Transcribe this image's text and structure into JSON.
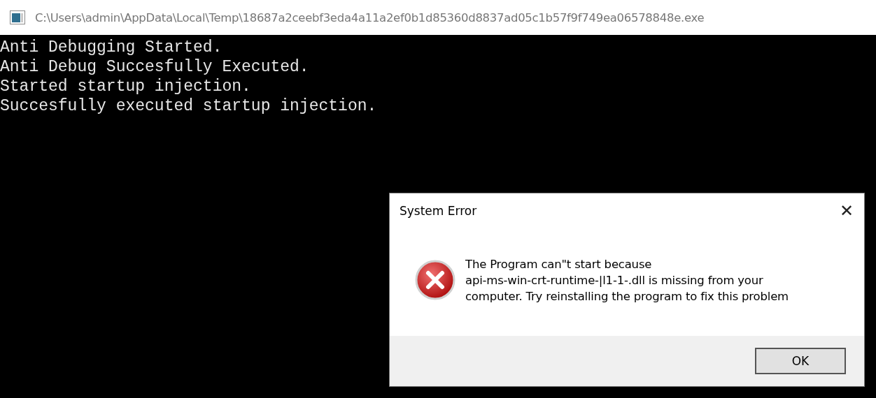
{
  "window": {
    "title": "C:\\Users\\admin\\AppData\\Local\\Temp\\18687a2ceebf3eda4a11a2ef0b1d85360d8837ad05c1b57f9f749ea06578848e.exe"
  },
  "console": {
    "lines": [
      "Anti Debugging Started.",
      "Anti Debug Succesfully Executed.",
      "Started startup injection.",
      "Succesfully executed startup injection."
    ]
  },
  "dialog": {
    "title": "System Error",
    "close": "✕",
    "message_lines": [
      "The Program can\"t start because",
      "api-ms-win-crt-runtime-|l1-1-.dll is missing from your",
      "computer. Try reinstalling the program to fix this problem"
    ],
    "buttons": [
      "OK"
    ]
  }
}
